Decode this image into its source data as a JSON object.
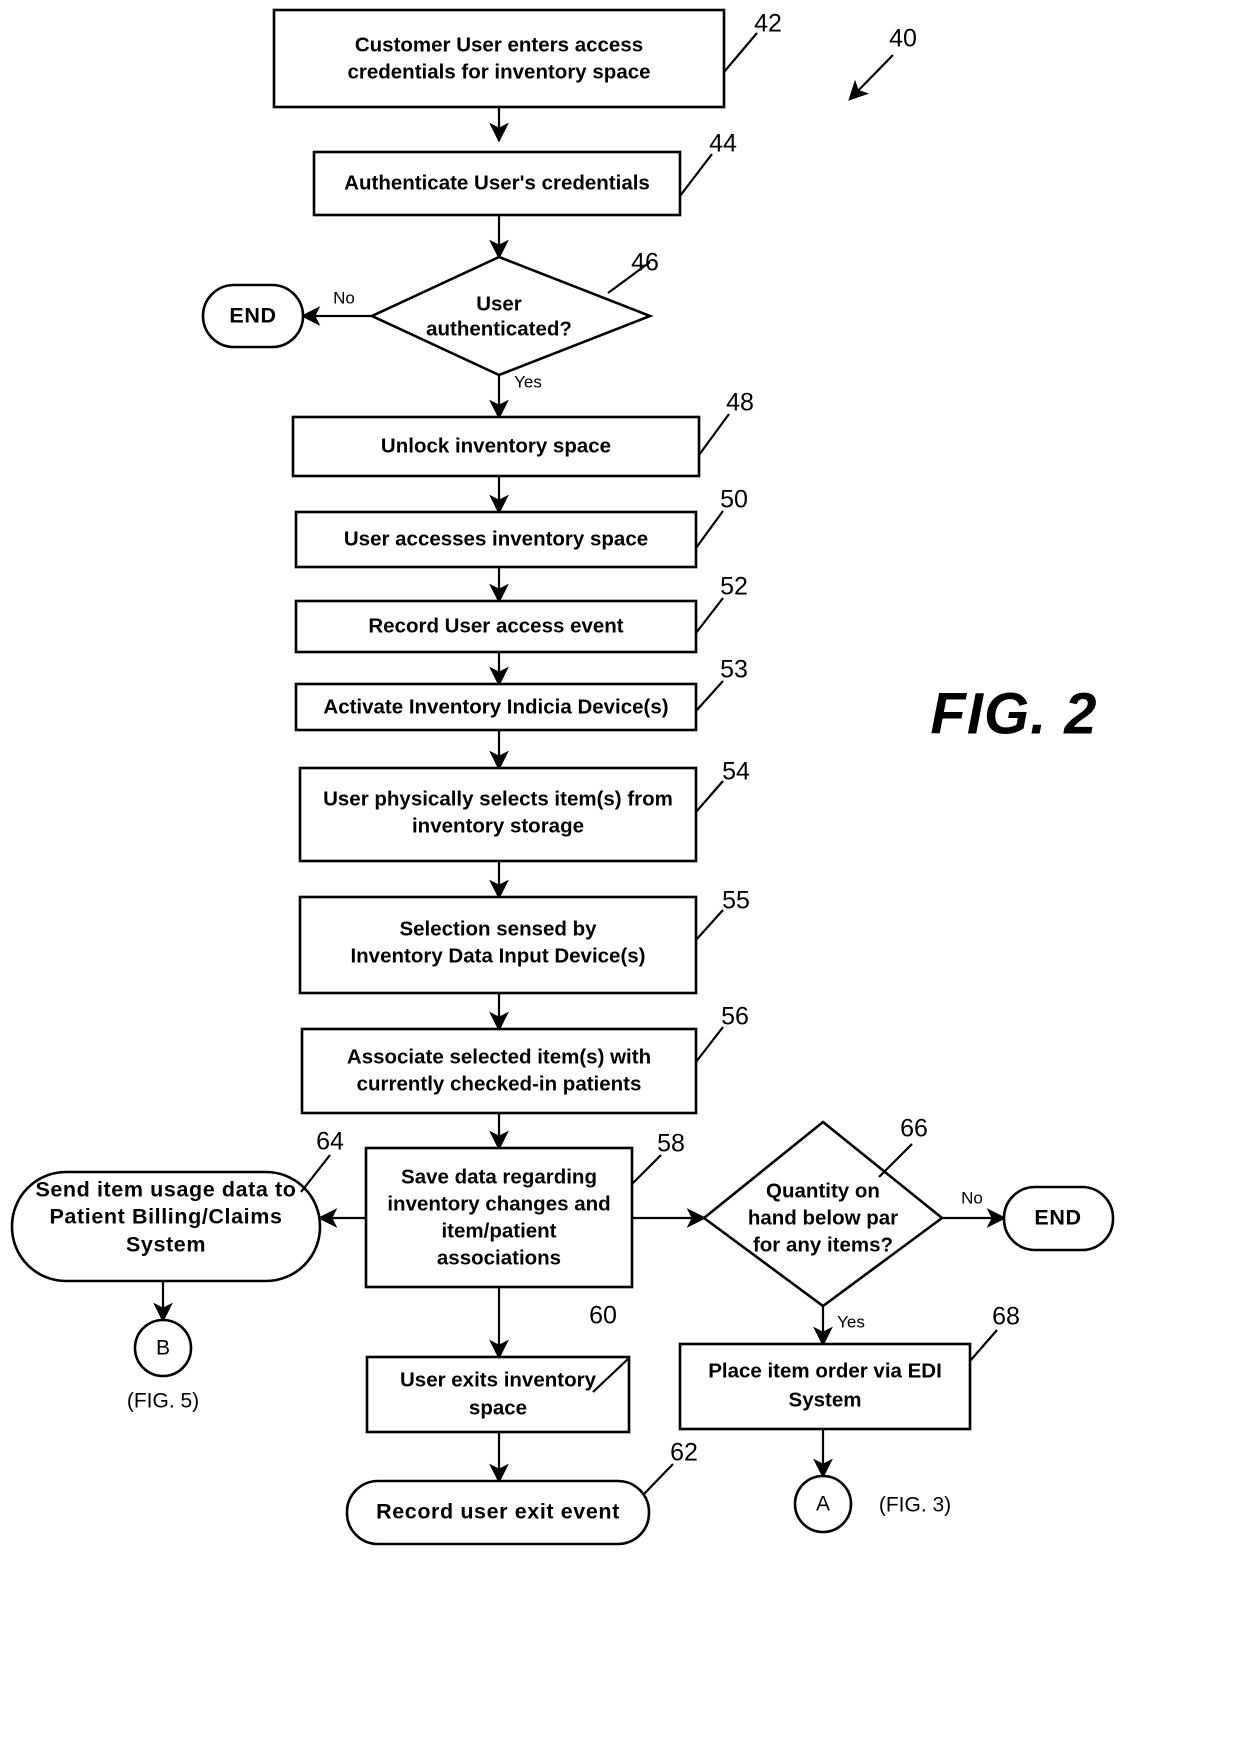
{
  "figure": {
    "title": "FIG. 2",
    "system_ref": "40"
  },
  "nodes": [
    {
      "id": "n42",
      "ref": "42",
      "type": "process",
      "lines": [
        "Customer User enters access",
        "credentials for inventory space"
      ]
    },
    {
      "id": "n44",
      "ref": "44",
      "type": "process",
      "lines": [
        "Authenticate User's credentials"
      ]
    },
    {
      "id": "n46",
      "ref": "46",
      "type": "decision",
      "lines": [
        "User",
        "authenticated?"
      ]
    },
    {
      "id": "end1",
      "ref": "",
      "type": "terminator",
      "lines": [
        "END"
      ]
    },
    {
      "id": "n48",
      "ref": "48",
      "type": "process",
      "lines": [
        "Unlock inventory space"
      ]
    },
    {
      "id": "n50",
      "ref": "50",
      "type": "process",
      "lines": [
        "User accesses inventory space"
      ]
    },
    {
      "id": "n52",
      "ref": "52",
      "type": "process",
      "lines": [
        "Record User access event"
      ]
    },
    {
      "id": "n53",
      "ref": "53",
      "type": "process",
      "lines": [
        "Activate Inventory Indicia Device(s)"
      ]
    },
    {
      "id": "n54",
      "ref": "54",
      "type": "process",
      "lines": [
        "User physically selects item(s) from",
        "inventory storage"
      ]
    },
    {
      "id": "n55",
      "ref": "55",
      "type": "process",
      "lines": [
        "Selection sensed by",
        "Inventory Data Input Device(s)"
      ]
    },
    {
      "id": "n56",
      "ref": "56",
      "type": "process",
      "lines": [
        "Associate selected item(s) with",
        "currently checked-in patients"
      ]
    },
    {
      "id": "n58",
      "ref": "58",
      "type": "process",
      "lines": [
        "Save data regarding",
        "inventory changes and",
        "item/patient",
        "associations"
      ]
    },
    {
      "id": "n64",
      "ref": "64",
      "type": "terminator",
      "lines": [
        "Send item usage data to",
        "Patient Billing/Claims",
        "System"
      ]
    },
    {
      "id": "n66",
      "ref": "66",
      "type": "decision",
      "lines": [
        "Quantity on",
        "hand below par",
        "for any items?"
      ]
    },
    {
      "id": "end2",
      "ref": "",
      "type": "terminator",
      "lines": [
        "END"
      ]
    },
    {
      "id": "n60",
      "ref": "60",
      "type": "process",
      "lines": [
        "User exits inventory",
        "space"
      ]
    },
    {
      "id": "n68",
      "ref": "68",
      "type": "process",
      "lines": [
        "Place item order via EDI",
        "System"
      ]
    },
    {
      "id": "n62",
      "ref": "62",
      "type": "terminator",
      "lines": [
        "Record user exit event"
      ]
    },
    {
      "id": "connB",
      "ref": "",
      "type": "connector",
      "lines": [
        "B"
      ]
    },
    {
      "id": "connA",
      "ref": "",
      "type": "connector",
      "lines": [
        "A"
      ]
    }
  ],
  "edge_labels": {
    "no_auth": "No",
    "yes_auth": "Yes",
    "no_par": "No",
    "yes_par": "Yes"
  },
  "offpage_refs": {
    "b_target": "(FIG. 5)",
    "a_target": "(FIG. 3)"
  }
}
